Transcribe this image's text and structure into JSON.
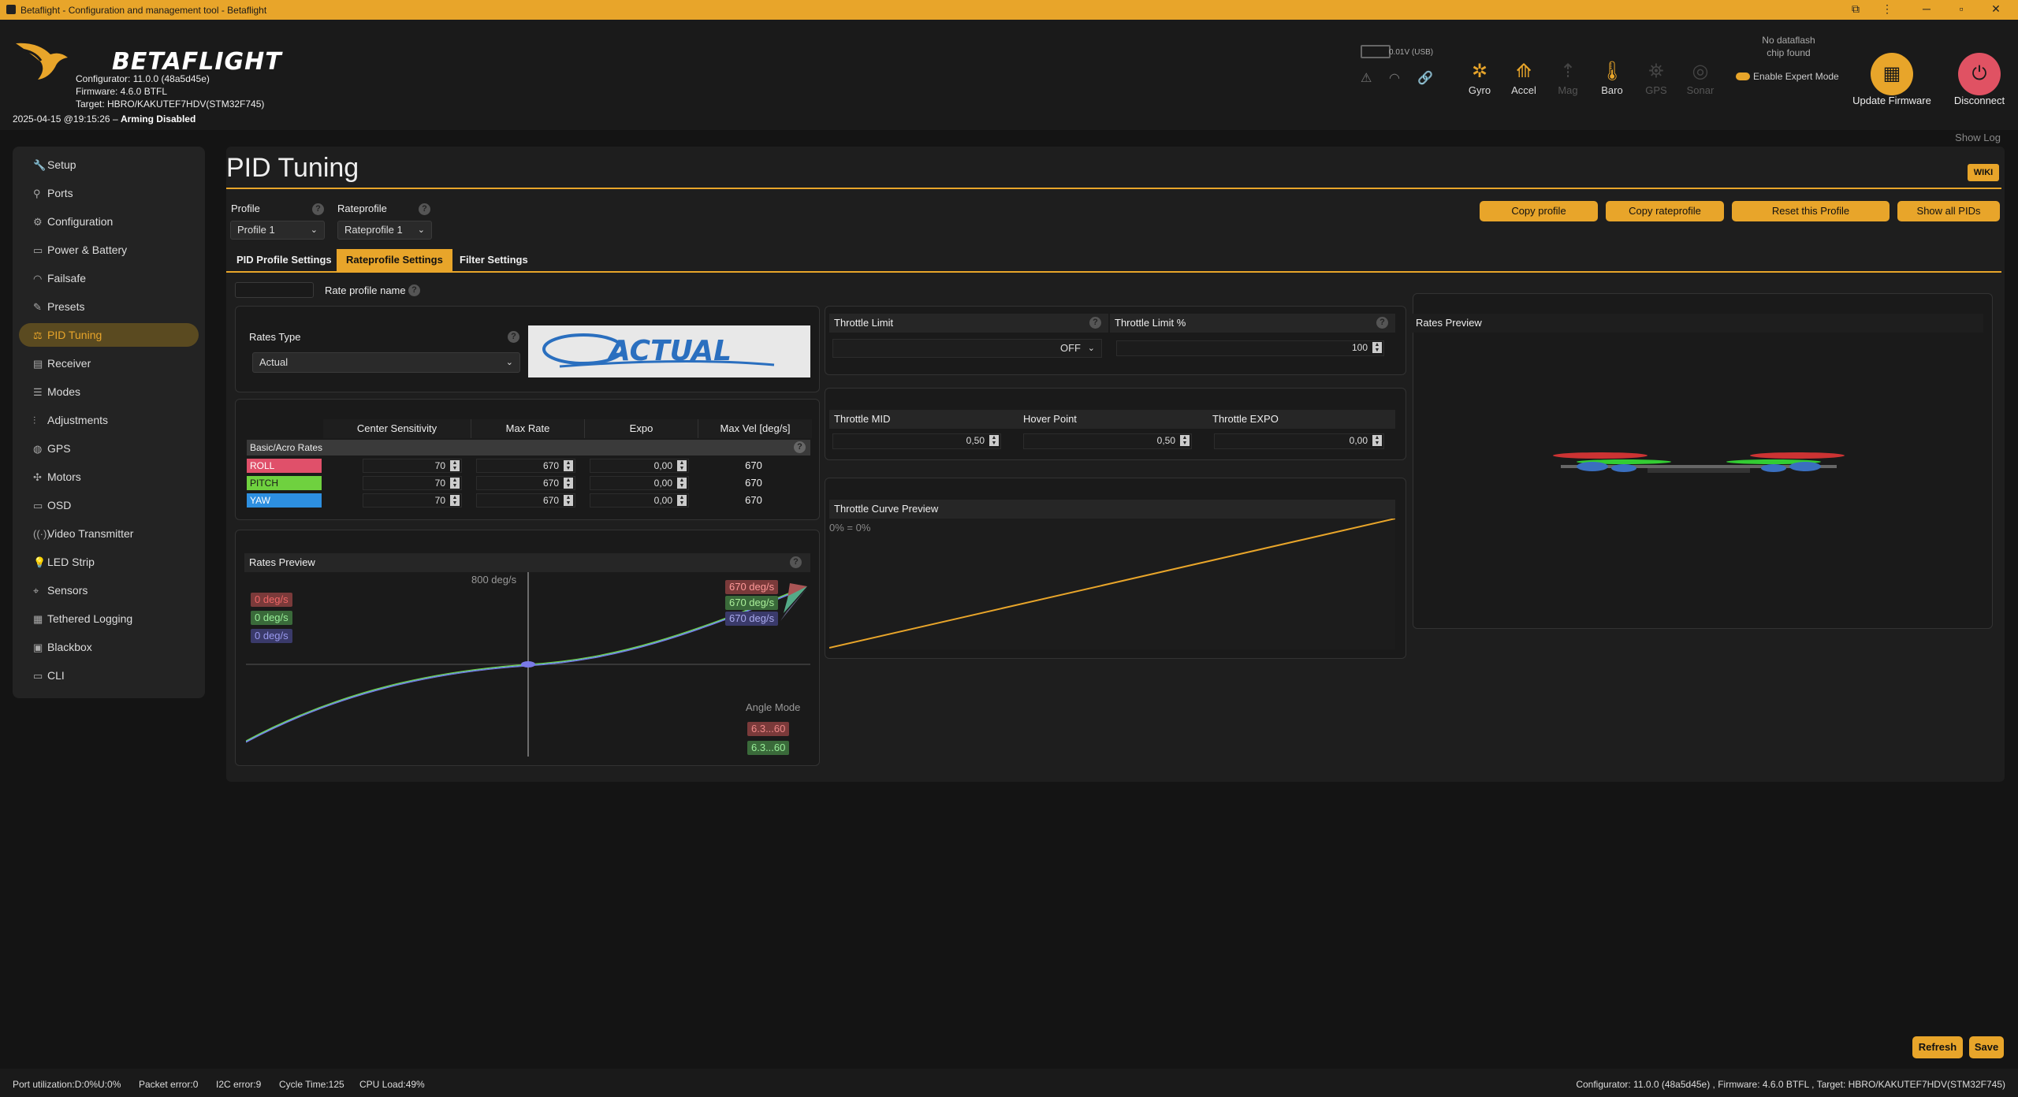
{
  "titlebar": {
    "title": "Betaflight - Configuration and management tool - Betaflight"
  },
  "header": {
    "logo": "BETAFLIGHT",
    "configurator": "Configurator: 11.0.0 (48a5d45e)",
    "firmware": "Firmware: 4.6.0 BTFL",
    "target": "Target: HBRO/KAKUTEF7HDV(STM32F745)",
    "datetime": "2025-04-15 @19:15:26 – ",
    "arming": "Arming Disabled",
    "battery": "0.01V (USB)",
    "sensors": [
      {
        "label": "Gyro",
        "active": true
      },
      {
        "label": "Accel",
        "active": true
      },
      {
        "label": "Mag",
        "active": false
      },
      {
        "label": "Baro",
        "active": true
      },
      {
        "label": "GPS",
        "active": false
      },
      {
        "label": "Sonar",
        "active": false
      }
    ],
    "dataflash": "No dataflash chip found",
    "expert_mode": "Enable Expert Mode",
    "update_firmware": "Update Firmware",
    "disconnect": "Disconnect",
    "show_log": "Show Log"
  },
  "sidebar": {
    "items": [
      {
        "label": "Setup",
        "icon": "wrench-icon",
        "glyph": "🔧"
      },
      {
        "label": "Ports",
        "icon": "plug-icon",
        "glyph": "⚲"
      },
      {
        "label": "Configuration",
        "icon": "gear-icon",
        "glyph": "⚙"
      },
      {
        "label": "Power & Battery",
        "icon": "battery-icon",
        "glyph": "▭"
      },
      {
        "label": "Failsafe",
        "icon": "signal-icon",
        "glyph": "◠"
      },
      {
        "label": "Presets",
        "icon": "presets-icon",
        "glyph": "✎"
      },
      {
        "label": "PID Tuning",
        "icon": "sliders-icon",
        "glyph": "⚖",
        "active": true
      },
      {
        "label": "Receiver",
        "icon": "receiver-icon",
        "glyph": "▤"
      },
      {
        "label": "Modes",
        "icon": "modes-icon",
        "glyph": "☰"
      },
      {
        "label": "Adjustments",
        "icon": "adjust-icon",
        "glyph": "⫶"
      },
      {
        "label": "GPS",
        "icon": "globe-icon",
        "glyph": "◍"
      },
      {
        "label": "Motors",
        "icon": "motor-icon",
        "glyph": "✣"
      },
      {
        "label": "OSD",
        "icon": "osd-icon",
        "glyph": "▭"
      },
      {
        "label": "Video Transmitter",
        "icon": "vtx-icon",
        "glyph": "((·))"
      },
      {
        "label": "LED Strip",
        "icon": "led-icon",
        "glyph": "💡"
      },
      {
        "label": "Sensors",
        "icon": "sensors-icon",
        "glyph": "⌖"
      },
      {
        "label": "Tethered Logging",
        "icon": "tether-icon",
        "glyph": "▦"
      },
      {
        "label": "Blackbox",
        "icon": "blackbox-icon",
        "glyph": "▣"
      },
      {
        "label": "CLI",
        "icon": "terminal-icon",
        "glyph": "▭"
      }
    ]
  },
  "page": {
    "title": "PID Tuning",
    "wiki": "WIKI",
    "profile_label": "Profile",
    "profile_value": "Profile 1",
    "rateprofile_label": "Rateprofile",
    "rateprofile_value": "Rateprofile 1",
    "buttons": {
      "copy_profile": "Copy profile",
      "copy_rateprofile": "Copy rateprofile",
      "reset_profile": "Reset this Profile",
      "show_all_pids": "Show all PIDs"
    },
    "tabs": [
      "PID Profile Settings",
      "Rateprofile Settings",
      "Filter Settings"
    ],
    "rate_profile_name": "Rate profile name",
    "rates_type_label": "Rates Type",
    "rates_type_value": "Actual",
    "rates_logo": "ACTUAL",
    "rates_table": {
      "headers": [
        "Center Sensitivity",
        "Max Rate",
        "Expo",
        "Max Vel [deg/s]"
      ],
      "section": "Basic/Acro Rates",
      "rows": [
        {
          "axis": "ROLL",
          "center": "70",
          "max": "670",
          "expo": "0,00",
          "vel": "670",
          "color": "#e0506a"
        },
        {
          "axis": "PITCH",
          "center": "70",
          "max": "670",
          "expo": "0,00",
          "vel": "670",
          "color": "#6fd13f"
        },
        {
          "axis": "YAW",
          "center": "70",
          "max": "670",
          "expo": "0,00",
          "vel": "670",
          "color": "#2d8fe0"
        }
      ]
    },
    "rates_preview": {
      "title": "Rates Preview",
      "scale_label": "800 deg/s",
      "live": [
        "0 deg/s",
        "0 deg/s",
        "0 deg/s"
      ],
      "max": [
        "670 deg/s",
        "670 deg/s",
        "670 deg/s"
      ],
      "angle_mode": "Angle Mode",
      "angle_values": [
        "6.3...60",
        "6.3...60"
      ]
    },
    "throttle": {
      "limit_label": "Throttle Limit",
      "limit_value": "OFF",
      "limit_pct_label": "Throttle Limit %",
      "limit_pct_value": "100",
      "mid_label": "Throttle MID",
      "mid_value": "0,50",
      "hover_label": "Hover Point",
      "hover_value": "0,50",
      "expo_label": "Throttle EXPO",
      "expo_value": "0,00",
      "curve_title": "Throttle Curve Preview",
      "curve_readout": "0% = 0%"
    },
    "rates_preview_3d": "Rates Preview",
    "refresh": "Refresh",
    "save": "Save"
  },
  "footer": {
    "port": "Port utilization:D:0%U:0%",
    "packet": "Packet error:0",
    "i2c": "I2C error:9",
    "cycle": "Cycle Time:125",
    "cpu": "CPU Load:49%",
    "version": "Configurator: 11.0.0 (48a5d45e) , Firmware: 4.6.0 BTFL , Target: HBRO/KAKUTEF7HDV(STM32F745)"
  }
}
